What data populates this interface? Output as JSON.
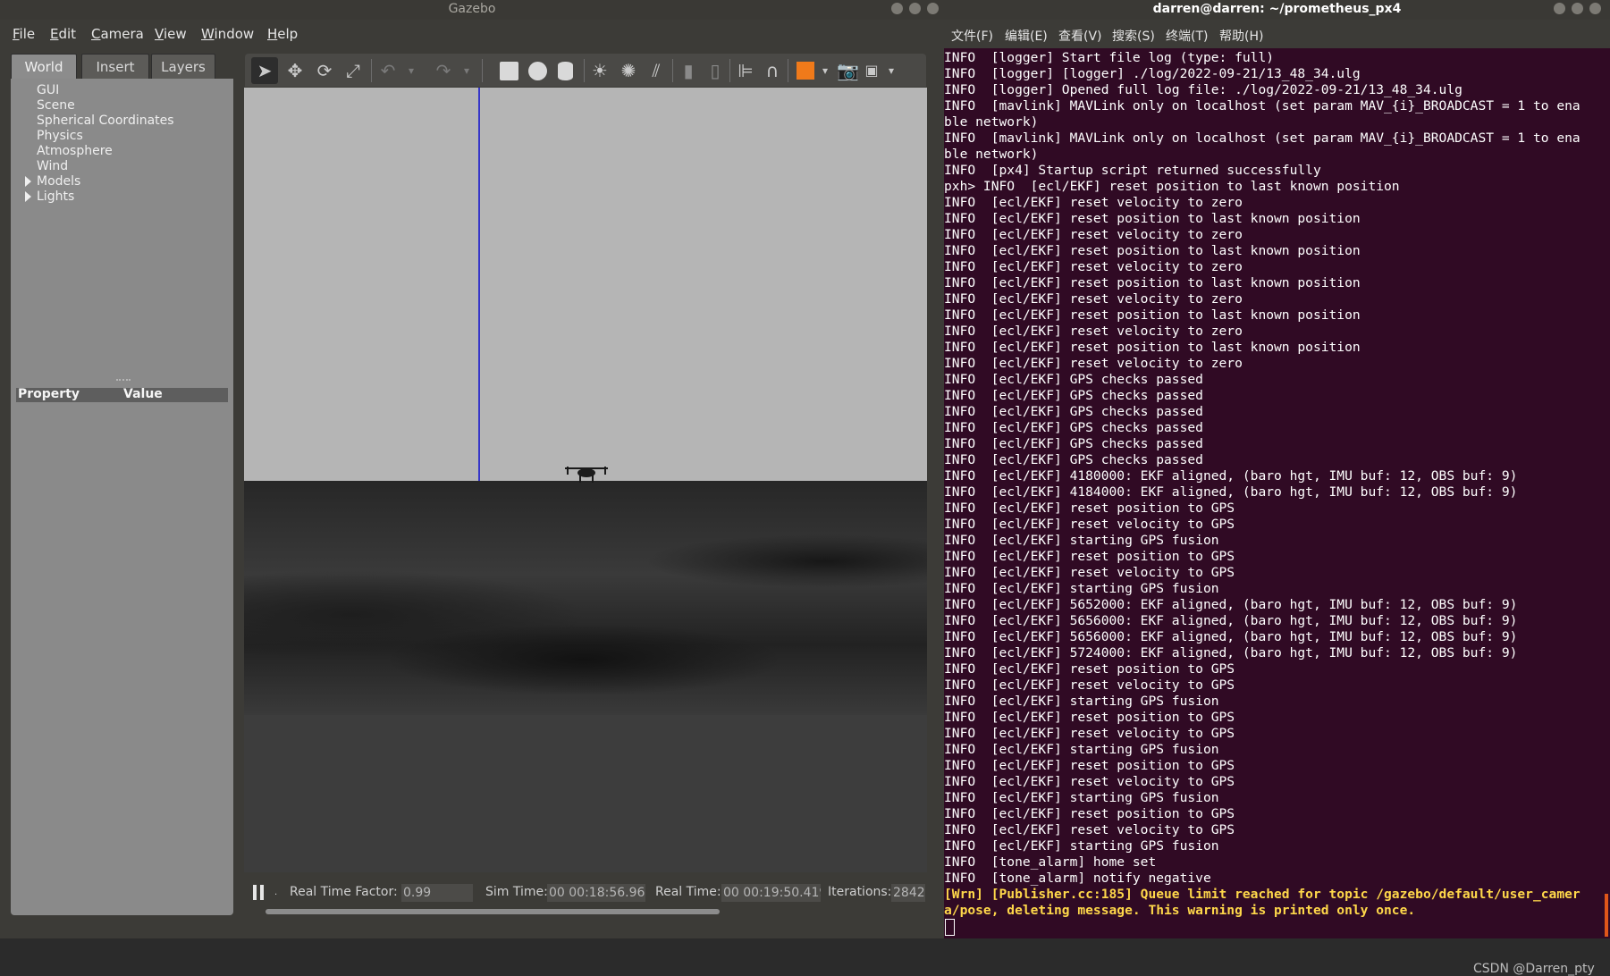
{
  "gazebo": {
    "title": "Gazebo",
    "menu": [
      "File",
      "Edit",
      "Camera",
      "View",
      "Window",
      "Help"
    ],
    "tabs": [
      "World",
      "Insert",
      "Layers"
    ],
    "world_tree": [
      "GUI",
      "Scene",
      "Spherical Coordinates",
      "Physics",
      "Atmosphere",
      "Wind"
    ],
    "world_tree_expandable": [
      "Models",
      "Lights"
    ],
    "property_header": {
      "property": "Property",
      "value": "Value"
    },
    "toolbar_icons": [
      "select-arrow-icon",
      "translate-icon",
      "rotate-icon",
      "scale-icon",
      "undo-icon",
      "redo-icon",
      "box-shape-icon",
      "sphere-shape-icon",
      "cylinder-shape-icon",
      "point-light-icon",
      "spot-light-icon",
      "directional-light-icon",
      "copy-icon",
      "paste-icon",
      "align-icon",
      "snap-icon",
      "view-angle-icon",
      "screenshot-icon",
      "record-log-icon"
    ],
    "status": {
      "real_time_factor_label": "Real Time Factor:",
      "real_time_factor": "0.99",
      "sim_time_label": "Sim Time:",
      "sim_time": "00 00:18:56.960",
      "real_time_label": "Real Time:",
      "real_time": "00 00:19:50.419",
      "iterations_label": "Iterations:",
      "iterations": "2842"
    },
    "colors": {
      "sky": "#b5b5b5",
      "axis": "#3636c8",
      "accent": "#f07a1a"
    }
  },
  "terminal": {
    "title": "darren@darren: ~/prometheus_px4",
    "menu": [
      "文件(F)",
      "编辑(E)",
      "查看(V)",
      "搜索(S)",
      "终端(T)",
      "帮助(H)"
    ],
    "lines": [
      "INFO  [logger] Start file log (type: full)",
      "INFO  [logger] [logger] ./log/2022-09-21/13_48_34.ulg",
      "INFO  [logger] Opened full log file: ./log/2022-09-21/13_48_34.ulg",
      "INFO  [mavlink] MAVLink only on localhost (set param MAV_{i}_BROADCAST = 1 to ena",
      "ble network)",
      "INFO  [mavlink] MAVLink only on localhost (set param MAV_{i}_BROADCAST = 1 to ena",
      "ble network)",
      "INFO  [px4] Startup script returned successfully",
      "pxh> INFO  [ecl/EKF] reset position to last known position",
      "INFO  [ecl/EKF] reset velocity to zero",
      "INFO  [ecl/EKF] reset position to last known position",
      "INFO  [ecl/EKF] reset velocity to zero",
      "INFO  [ecl/EKF] reset position to last known position",
      "INFO  [ecl/EKF] reset velocity to zero",
      "INFO  [ecl/EKF] reset position to last known position",
      "INFO  [ecl/EKF] reset velocity to zero",
      "INFO  [ecl/EKF] reset position to last known position",
      "INFO  [ecl/EKF] reset velocity to zero",
      "INFO  [ecl/EKF] reset position to last known position",
      "INFO  [ecl/EKF] reset velocity to zero",
      "INFO  [ecl/EKF] GPS checks passed",
      "INFO  [ecl/EKF] GPS checks passed",
      "INFO  [ecl/EKF] GPS checks passed",
      "INFO  [ecl/EKF] GPS checks passed",
      "INFO  [ecl/EKF] GPS checks passed",
      "INFO  [ecl/EKF] GPS checks passed",
      "INFO  [ecl/EKF] 4180000: EKF aligned, (baro hgt, IMU buf: 12, OBS buf: 9)",
      "INFO  [ecl/EKF] 4184000: EKF aligned, (baro hgt, IMU buf: 12, OBS buf: 9)",
      "INFO  [ecl/EKF] reset position to GPS",
      "INFO  [ecl/EKF] reset velocity to GPS",
      "INFO  [ecl/EKF] starting GPS fusion",
      "INFO  [ecl/EKF] reset position to GPS",
      "INFO  [ecl/EKF] reset velocity to GPS",
      "INFO  [ecl/EKF] starting GPS fusion",
      "INFO  [ecl/EKF] 5652000: EKF aligned, (baro hgt, IMU buf: 12, OBS buf: 9)",
      "INFO  [ecl/EKF] 5656000: EKF aligned, (baro hgt, IMU buf: 12, OBS buf: 9)",
      "INFO  [ecl/EKF] 5656000: EKF aligned, (baro hgt, IMU buf: 12, OBS buf: 9)",
      "INFO  [ecl/EKF] 5724000: EKF aligned, (baro hgt, IMU buf: 12, OBS buf: 9)",
      "INFO  [ecl/EKF] reset position to GPS",
      "INFO  [ecl/EKF] reset velocity to GPS",
      "INFO  [ecl/EKF] starting GPS fusion",
      "INFO  [ecl/EKF] reset position to GPS",
      "INFO  [ecl/EKF] reset velocity to GPS",
      "INFO  [ecl/EKF] starting GPS fusion",
      "INFO  [ecl/EKF] reset position to GPS",
      "INFO  [ecl/EKF] reset velocity to GPS",
      "INFO  [ecl/EKF] starting GPS fusion",
      "INFO  [ecl/EKF] reset position to GPS",
      "INFO  [ecl/EKF] reset velocity to GPS",
      "INFO  [ecl/EKF] starting GPS fusion",
      "INFO  [tone_alarm] home set",
      "INFO  [tone_alarm] notify negative"
    ],
    "warning_lines": [
      "[Wrn] [Publisher.cc:185] Queue limit reached for topic /gazebo/default/user_camer",
      "a/pose, deleting message. This warning is printed only once."
    ],
    "watermark": "CSDN @Darren_pty",
    "colors": {
      "background": "#300a24",
      "text": "#ffffff",
      "warning": "#ffd84a"
    }
  }
}
